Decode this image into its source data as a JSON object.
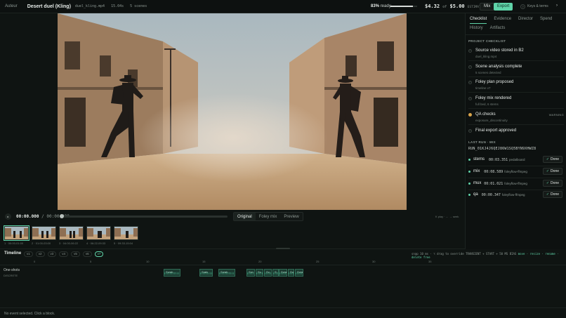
{
  "header": {
    "brand": "Auteur",
    "title": "Desert duel (Kling)",
    "file": "duel_kling.mp4",
    "duration": "15.04s",
    "scenes": "5 scenes",
    "ready_percent": "83%",
    "ready_label": "ready",
    "ready_value": 0.83,
    "cost": "$4.32",
    "cost_of": "of",
    "cost_total": "$5.00",
    "cost_label": "ESTIMATE",
    "mix_label": "Mix",
    "export_label": "Export",
    "help_label": "?",
    "keys_label": "Keys & terms",
    "collapse_label": "›"
  },
  "player": {
    "play_label": "▸",
    "current_time": "00:00.000",
    "total_time": "/ 00:00.000",
    "modes": [
      "Original",
      "Foley mix",
      "Preview"
    ],
    "active_mode": "Original",
    "play_hint": "K play · ← → seek"
  },
  "scenes": [
    {
      "label": "1 · 00:00-01:00"
    },
    {
      "label": "2 · 01:00-03:00"
    },
    {
      "label": "3 · 04:00-06:22"
    },
    {
      "label": "4 · 06:22-09:33"
    },
    {
      "label": "5 · 09:33-15:04"
    }
  ],
  "timeline": {
    "title": "Timeline",
    "versions": [
      "v1",
      "v2",
      "v3",
      "v4",
      "v5",
      "v6",
      "v7"
    ],
    "active_version": "v7",
    "hint_pre": "snap 10 ms · ⌥ drag to override",
    "hint_mid": "TRANSIENT + START + 50 MS BIAS",
    "hint_post": "move · resize · rename · delete free",
    "ruler": [
      "0",
      "5",
      "10",
      "15",
      "20",
      "25",
      "30",
      "35"
    ],
    "track_label": "One-shots",
    "track_sub": "DISCRETE",
    "clips": [
      "Gunsh…",
      "Gusts",
      "Gunsh…",
      "Gun…",
      "Gu…",
      "Gu…",
      "G…",
      "Gunsh…",
      "Gunsh…",
      "Gunshot ga…"
    ],
    "status": "No event selected. Click a block."
  },
  "panel": {
    "tabs": [
      "Checklist",
      "Evidence",
      "Director",
      "Spend",
      "History",
      "Artifacts"
    ],
    "active_tab": "Checklist",
    "section_title": "PROJECT CHECKLIST",
    "checklist": [
      {
        "title": "Source video stored in B2",
        "sub": "duel_kling.mp4",
        "mark": "✓",
        "warning": ""
      },
      {
        "title": "Scene analysis complete",
        "sub": "5 scenes detected",
        "mark": "✓",
        "warning": ""
      },
      {
        "title": "Foley plan proposed",
        "sub": "timeline v7",
        "mark": "✓",
        "warning": ""
      },
      {
        "title": "Foley mix rendered",
        "sub": "full bed, 6 stems",
        "mark": "✓",
        "warning": ""
      },
      {
        "title": "QA checks",
        "sub": "exposure_discontinuity",
        "mark": "",
        "warning": "WARNING"
      },
      {
        "title": "Final export approved",
        "sub": "",
        "mark": "✓",
        "warning": ""
      }
    ],
    "last_run_label": "LAST RUN · MIX",
    "run_id": "RUN_01KJ4J6QEJ86W1SQ5BYN9XHWZ8",
    "stages": [
      {
        "name": "stems",
        "duration": "00:03.351",
        "tool": "pedalboard",
        "status": "Done",
        "mark": "✓"
      },
      {
        "name": "mix",
        "duration": "00:08.589",
        "tool": "foleyflow-ffmpeg",
        "status": "Done",
        "mark": "✓"
      },
      {
        "name": "mux",
        "duration": "00:01.021",
        "tool": "foleyflow-ffmpeg",
        "status": "Done",
        "mark": "✓"
      },
      {
        "name": "qa",
        "duration": "00:00.347",
        "tool": "foleyflow-ffmpeg",
        "status": "Done",
        "mark": "✓"
      }
    ]
  },
  "colors": {
    "accent": "#5fd3a8",
    "warning": "#d9a44a",
    "bg": "#0f1412"
  }
}
